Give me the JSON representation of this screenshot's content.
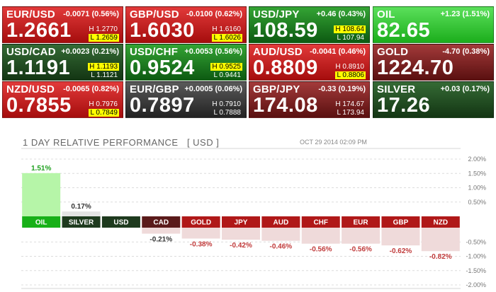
{
  "tiles": [
    {
      "symbol": "EUR/USD",
      "change": "-0.0071 (0.56%)",
      "price": "1.2661",
      "high": "H 1.2770",
      "low": "L 1.2659",
      "hit": "low",
      "style": "red"
    },
    {
      "symbol": "GBP/USD",
      "change": "-0.0100 (0.62%)",
      "price": "1.6030",
      "high": "H 1.6160",
      "low": "L 1.6026",
      "hit": "low",
      "style": "red"
    },
    {
      "symbol": "USD/JPY",
      "change": "+0.46 (0.43%)",
      "price": "108.59",
      "high": "H 108.64",
      "low": "L 107.94",
      "hit": "high",
      "style": "green"
    },
    {
      "symbol": "OIL",
      "change": "+1.23 (1.51%)",
      "price": "82.65",
      "high": "",
      "low": "",
      "hit": "",
      "style": "bright-green"
    },
    {
      "symbol": "USD/CAD",
      "change": "+0.0023 (0.21%)",
      "price": "1.1191",
      "high": "H 1.1193",
      "low": "L 1.1121",
      "hit": "high",
      "style": "dark-green"
    },
    {
      "symbol": "USD/CHF",
      "change": "+0.0053 (0.56%)",
      "price": "0.9524",
      "high": "H 0.9525",
      "low": "L 0.9441",
      "hit": "high",
      "style": "green"
    },
    {
      "symbol": "AUD/USD",
      "change": "-0.0041 (0.46%)",
      "price": "0.8809",
      "high": "H 0.8910",
      "low": "L 0.8806",
      "hit": "low",
      "style": "red"
    },
    {
      "symbol": "GOLD",
      "change": "-4.70 (0.38%)",
      "price": "1224.70",
      "high": "",
      "low": "",
      "hit": "",
      "style": "dark-red"
    },
    {
      "symbol": "NZD/USD",
      "change": "-0.0065 (0.82%)",
      "price": "0.7855",
      "high": "H 0.7976",
      "low": "L 0.7849",
      "hit": "low",
      "style": "red"
    },
    {
      "symbol": "EUR/GBP",
      "change": "+0.0005 (0.06%)",
      "price": "0.7897",
      "high": "H 0.7910",
      "low": "L 0.7888",
      "hit": "",
      "style": "grey"
    },
    {
      "symbol": "GBP/JPY",
      "change": "-0.33 (0.19%)",
      "price": "174.08",
      "high": "H 174.67",
      "low": "L 173.94",
      "hit": "",
      "style": "dark-red"
    },
    {
      "symbol": "SILVER",
      "change": "+0.03 (0.17%)",
      "price": "17.26",
      "high": "",
      "low": "",
      "hit": "",
      "style": "dark-green"
    }
  ],
  "chart_title": "1 DAY RELATIVE PERFORMANCE   [ USD ]",
  "chart_timestamp": "OCT 29 2014 02:09 PM",
  "chart_data": {
    "type": "bar",
    "title": "1 DAY RELATIVE PERFORMANCE [ USD ]",
    "categories": [
      "OIL",
      "SILVER",
      "USD",
      "CAD",
      "GOLD",
      "JPY",
      "AUD",
      "CHF",
      "EUR",
      "GBP",
      "NZD"
    ],
    "values": [
      1.51,
      0.17,
      0.0,
      -0.21,
      -0.38,
      -0.42,
      -0.46,
      -0.56,
      -0.56,
      -0.62,
      -0.82
    ],
    "value_labels": [
      "1.51%",
      "0.17%",
      "",
      "-0.21%",
      "-0.38%",
      "-0.42%",
      "-0.46%",
      "-0.56%",
      "-0.56%",
      "-0.62%",
      "-0.82%"
    ],
    "yticks": [
      2.0,
      1.5,
      1.0,
      0.5,
      -0.5,
      -1.0,
      -1.5,
      -2.0
    ],
    "ytick_labels": [
      "2.00%",
      "1.50%",
      "1.00%",
      "0.50%",
      "-0.50%",
      "-1.00%",
      "-1.50%",
      "-2.00%"
    ],
    "ylim": [
      -2.0,
      2.0
    ],
    "grid": true,
    "colors": {
      "positive_strong": "#b6f5a8",
      "positive_weak": "#e4e4e4",
      "negative": "#efdada",
      "label_green": "#1ea01e",
      "label_red": "#c03a3a",
      "label_box_green": "#18b018",
      "label_box_dark": "#1e3a1e",
      "label_box_red": "#b01818",
      "label_box_neutral": "#b85050"
    }
  }
}
